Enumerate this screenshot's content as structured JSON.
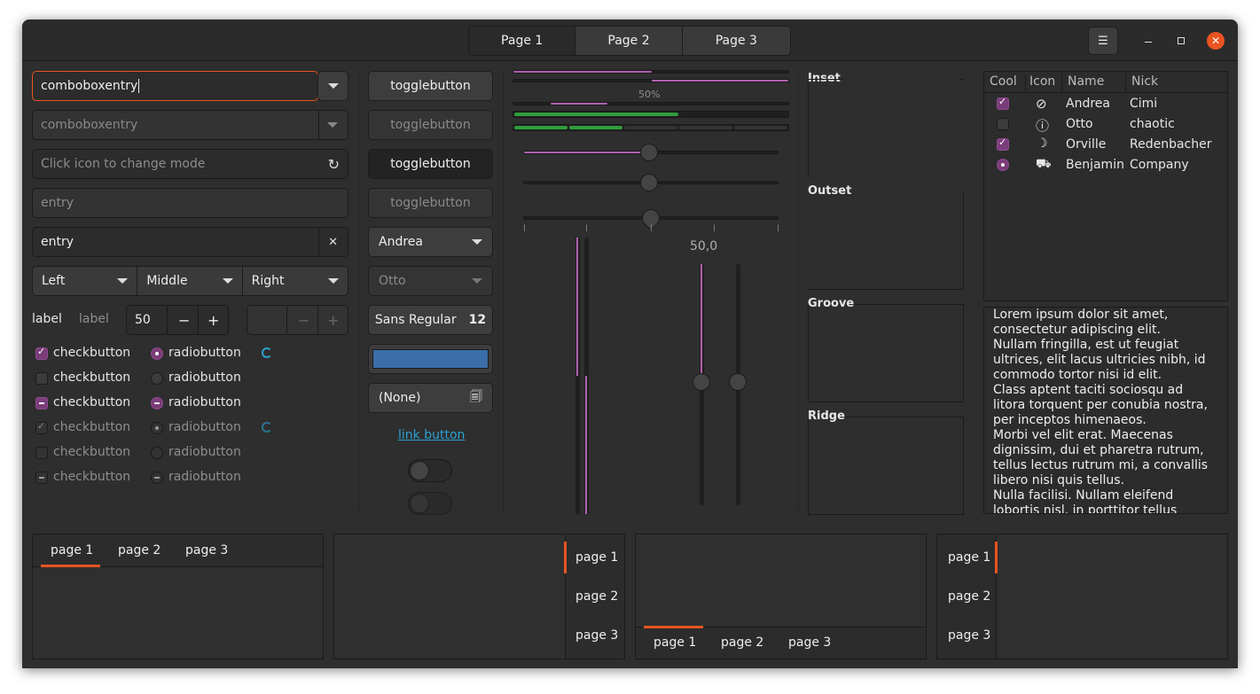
{
  "header": {
    "pages": [
      "Page 1",
      "Page 2",
      "Page 3"
    ],
    "selected": 0
  },
  "col1": {
    "combo1": "comboboxentry",
    "combo2": "comboboxentry",
    "entry_mode_placeholder": "Click icon to change mode",
    "entry_placeholder": "entry",
    "entry_value": "entry",
    "segment": [
      "Left",
      "Middle",
      "Right"
    ],
    "label1": "label",
    "label2": "label",
    "spin1": "50",
    "checks": [
      "checkbutton",
      "checkbutton",
      "checkbutton",
      "checkbutton",
      "checkbutton",
      "checkbutton"
    ],
    "radios": [
      "radiobutton",
      "radiobutton",
      "radiobutton",
      "radiobutton",
      "radiobutton",
      "radiobutton"
    ]
  },
  "col2": {
    "toggles": [
      "togglebutton",
      "togglebutton",
      "togglebutton",
      "togglebutton"
    ],
    "combo_andrea": "Andrea",
    "combo_otto": "Otto",
    "font_name": "Sans Regular",
    "font_size": "12",
    "color": "#3b6ea8",
    "file": "(None)",
    "link": "link button"
  },
  "col3": {
    "progress_label": "50%",
    "scale_label": "50,0",
    "progress_value": 0.5
  },
  "frames": [
    "Inset",
    "Outset",
    "Groove",
    "Ridge"
  ],
  "tree": {
    "columns": [
      "Cool",
      "Icon",
      "Name",
      "Nick"
    ],
    "rows": [
      {
        "cool": "check",
        "icon": "check-circle-icon",
        "name": "Andrea",
        "nick": "Cimi"
      },
      {
        "cool": "none",
        "icon": "exclamation-icon",
        "name": "Otto",
        "nick": "chaotic"
      },
      {
        "cool": "check",
        "icon": "moon-icon",
        "name": "Orville",
        "nick": "Redenbacher"
      },
      {
        "cool": "radio",
        "icon": "car-icon",
        "name": "Benjamin",
        "nick": "Company"
      }
    ]
  },
  "text": "Lorem ipsum dolor sit amet, consectetur adipiscing elit.\nNullam fringilla, est ut feugiat ultrices, elit lacus ultricies nibh, id commodo tortor nisi id elit.\nClass aptent taciti sociosqu ad litora torquent per conubia nostra, per inceptos himenaeos.\nMorbi vel elit erat. Maecenas dignissim, dui et pharetra rutrum, tellus lectus rutrum mi, a convallis libero nisi quis tellus.\nNulla facilisi. Nullam eleifend lobortis nisl, in porttitor tellus",
  "notebooks": {
    "tabs": [
      "page 1",
      "page 2",
      "page 3"
    ]
  },
  "colors": {
    "accent": "#e95420",
    "purple": "#b160b1",
    "green": "#2f9e3c",
    "link": "#2aa1d3"
  }
}
